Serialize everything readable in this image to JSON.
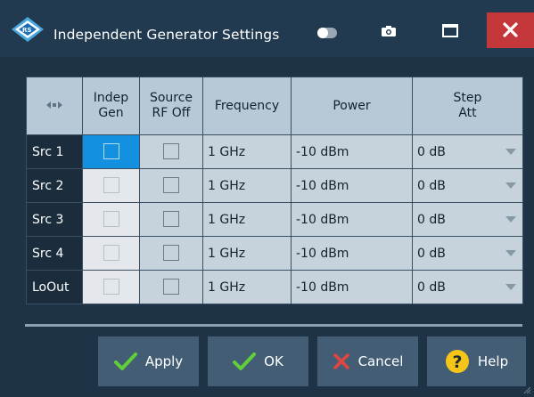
{
  "window": {
    "title": "Independent Generator Settings",
    "close_color": "#c4373b"
  },
  "titlebar": {
    "logo": "rohde-schwarz-logo",
    "icons": [
      "toggle-icon",
      "camera-icon",
      "maximize-icon",
      "close-icon"
    ]
  },
  "grid": {
    "corner_icon": "column-resize-icon",
    "columns": [
      "Indep Gen",
      "Source RF Off",
      "Frequency",
      "Power",
      "Step Att"
    ],
    "column_lines": [
      [
        "Indep",
        "Gen"
      ],
      [
        "Source",
        "RF Off"
      ],
      [
        "Frequency"
      ],
      [
        "Power"
      ],
      [
        "Step",
        "Att"
      ]
    ],
    "rows": [
      {
        "name": "Src 1",
        "indep_gen": false,
        "rf_off": false,
        "frequency": "1 GHz",
        "power": "-10 dBm",
        "step_att": "0 dB",
        "indep_gen_selected": true
      },
      {
        "name": "Src 2",
        "indep_gen": false,
        "rf_off": false,
        "frequency": "1 GHz",
        "power": "-10 dBm",
        "step_att": "0 dB"
      },
      {
        "name": "Src 3",
        "indep_gen": false,
        "rf_off": false,
        "frequency": "1 GHz",
        "power": "-10 dBm",
        "step_att": "0 dB"
      },
      {
        "name": "Src 4",
        "indep_gen": false,
        "rf_off": false,
        "frequency": "1 GHz",
        "power": "-10 dBm",
        "step_att": "0 dB"
      },
      {
        "name": "LoOut",
        "indep_gen": false,
        "rf_off": false,
        "frequency": "1 GHz",
        "power": "-10 dBm",
        "step_att": "0 dB"
      }
    ]
  },
  "buttons": {
    "apply": "Apply",
    "ok": "OK",
    "cancel": "Cancel",
    "help": "Help"
  },
  "colors": {
    "background": "#1e3446",
    "header": "#b7c9d6",
    "cell": "#c6d2dc",
    "selection": "#1490e0",
    "button": "#435e74",
    "check_green": "#5fcf3a",
    "cancel_red": "#e0453f",
    "help_yellow": "#f5c518"
  }
}
